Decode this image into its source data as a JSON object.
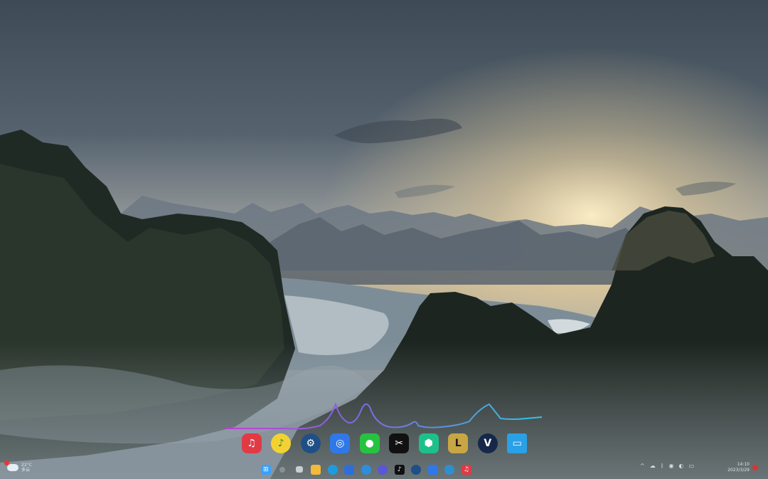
{
  "desktop": {
    "wallpaper": "karst mountains at sunrise with rice terraces and mist"
  },
  "visualizer": {
    "colors": [
      "#c43bd9",
      "#7a6de0",
      "#2fc6e6"
    ]
  },
  "dock": {
    "apps": [
      {
        "name": "netease-cloud-music",
        "icon": "music-note-icon",
        "color": "#e03a45"
      },
      {
        "name": "qq-music",
        "icon": "music-icon",
        "color": "#f2d233"
      },
      {
        "name": "steam",
        "icon": "steam-icon",
        "color": "#1f4f87"
      },
      {
        "name": "screenshot-tool",
        "icon": "camera-icon",
        "color": "#2f78e8"
      },
      {
        "name": "wechat",
        "icon": "chat-bubble-icon",
        "color": "#28c241"
      },
      {
        "name": "capcut",
        "icon": "scissors-icon",
        "color": "#111111"
      },
      {
        "name": "app-green-hex",
        "icon": "hexagon-icon",
        "color": "#1ec08a"
      },
      {
        "name": "league-of-legends",
        "icon": "game-icon",
        "color": "#c8a545"
      },
      {
        "name": "v-app",
        "icon": "v-icon",
        "color": "#16284a"
      },
      {
        "name": "this-pc",
        "icon": "monitor-icon",
        "color": "#2aa0e6"
      }
    ]
  },
  "taskbar": {
    "icons": [
      {
        "name": "start",
        "color": "#3aa0ff"
      },
      {
        "name": "search",
        "color": "#8a8f99"
      },
      {
        "name": "task-view",
        "color": "#c9ced6"
      },
      {
        "name": "file-explorer",
        "color": "#f2b93a"
      },
      {
        "name": "edge",
        "color": "#1e9be0"
      },
      {
        "name": "store",
        "color": "#2f6ed8"
      },
      {
        "name": "edge-dev",
        "color": "#2b8fdc"
      },
      {
        "name": "app-purple",
        "color": "#5b55d8"
      },
      {
        "name": "tiktok",
        "color": "#111111"
      },
      {
        "name": "steam",
        "color": "#1f4f87"
      },
      {
        "name": "screenshot-tool",
        "color": "#2f78e8"
      },
      {
        "name": "app-globe",
        "color": "#2e8fd0"
      },
      {
        "name": "netease-cloud-music",
        "color": "#e03a45"
      }
    ],
    "weather": {
      "line1": "22°C",
      "line2": "多云"
    },
    "tray": [
      {
        "name": "chevron-up",
        "glyph": "^"
      },
      {
        "name": "cloud",
        "glyph": "☁"
      },
      {
        "name": "bluetooth",
        "glyph": "ᛒ"
      },
      {
        "name": "wifi",
        "glyph": "◉"
      },
      {
        "name": "volume",
        "glyph": "◐"
      },
      {
        "name": "battery",
        "glyph": "▭"
      }
    ],
    "clock": {
      "time": "14:10",
      "date": "2023/3/29"
    }
  }
}
